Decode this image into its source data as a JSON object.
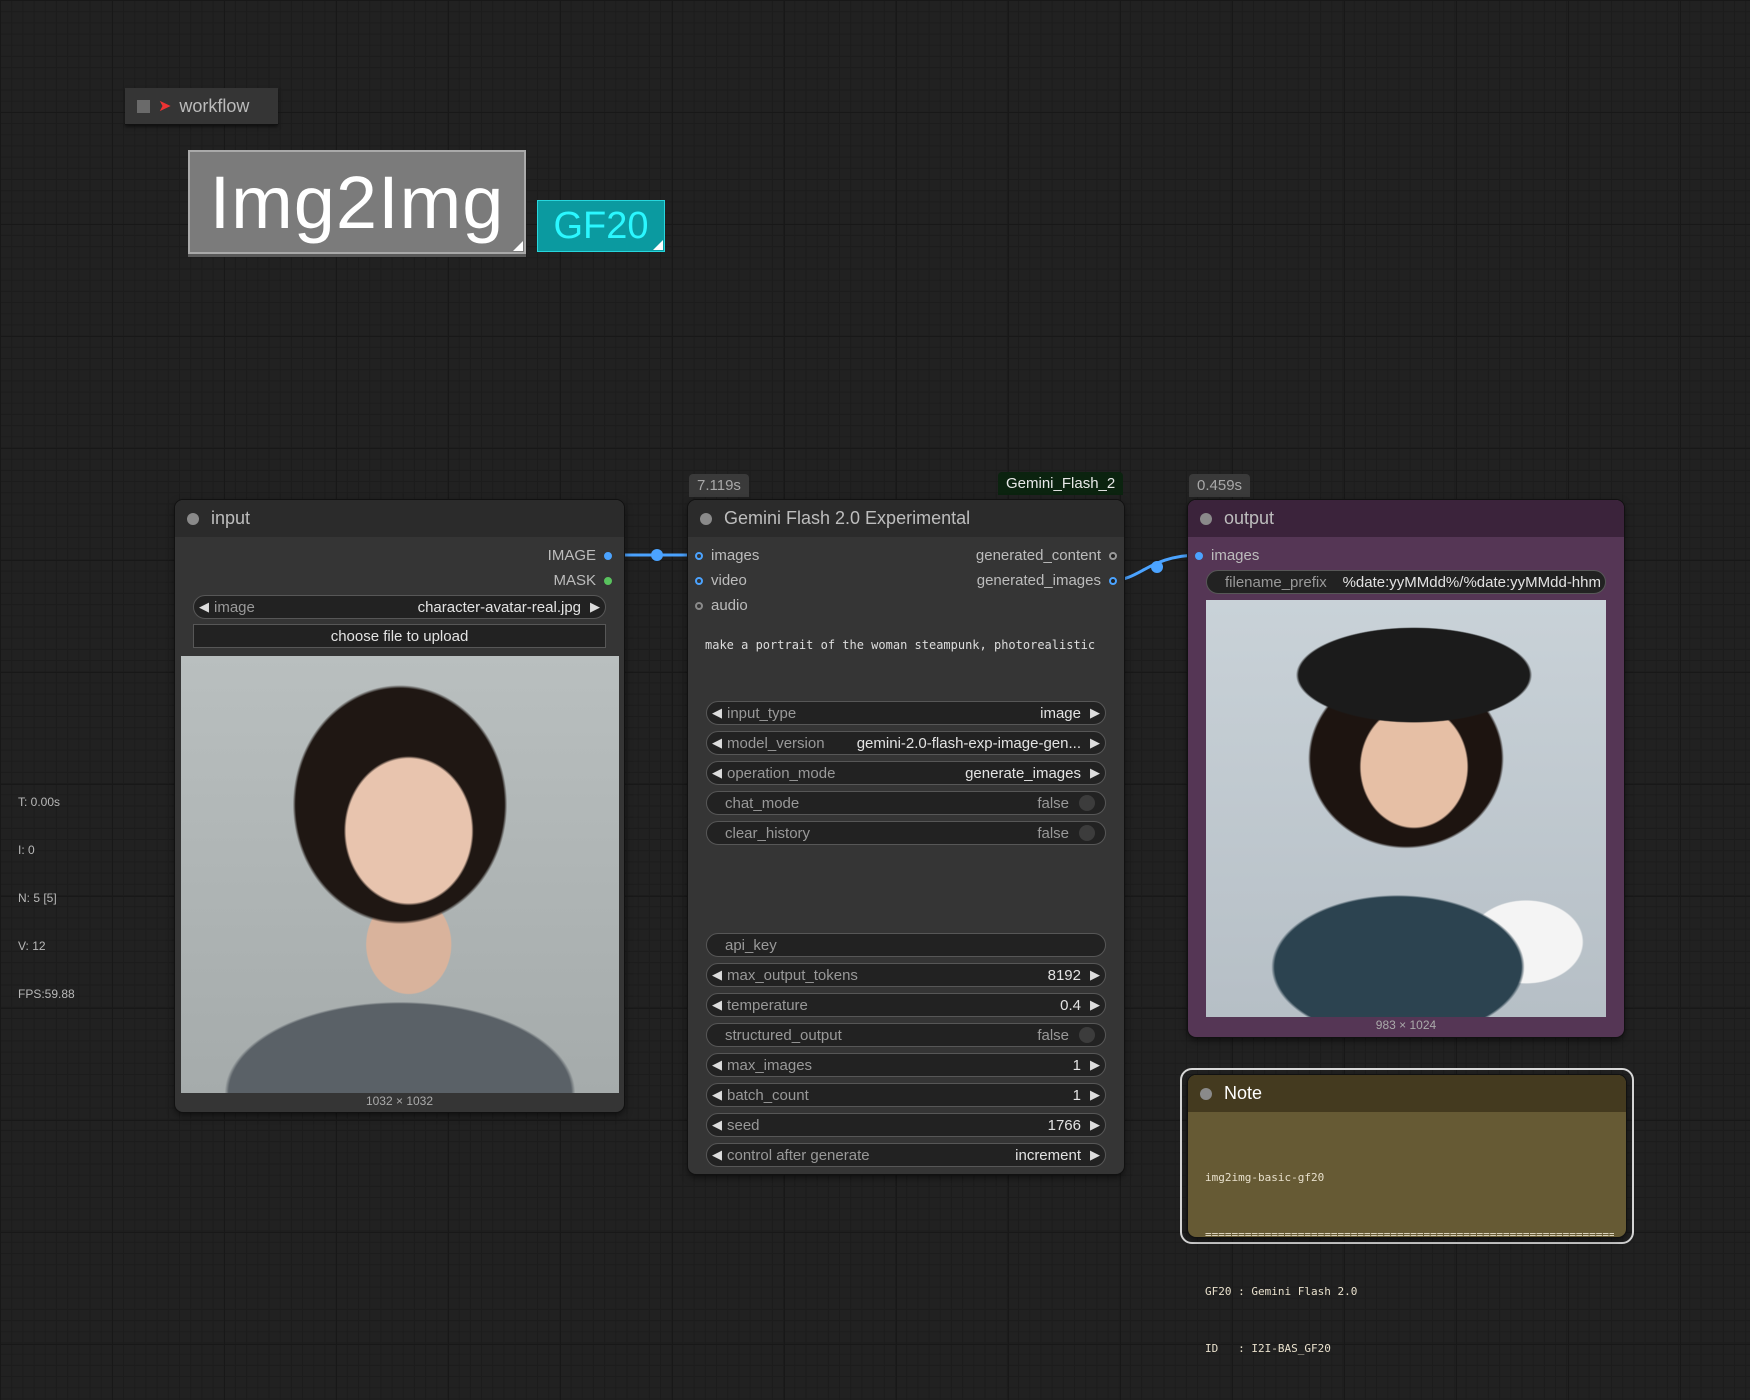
{
  "workflow": {
    "label": "workflow"
  },
  "title_label": "Img2Img",
  "badge_label": "GF20",
  "stats": {
    "t": "T: 0.00s",
    "i": "I: 0",
    "n": "N: 5 [5]",
    "v": "V: 12",
    "fps": "FPS:59.88"
  },
  "input_node": {
    "title": "input",
    "outputs": [
      "IMAGE",
      "MASK"
    ],
    "image_widget": {
      "name": "image",
      "value": "character-avatar-real.jpg"
    },
    "upload_label": "choose file to upload",
    "image_dims": "1032 × 1032"
  },
  "gemini_node": {
    "timing": "7.119s",
    "badge": "Gemini_Flash_2",
    "title": "Gemini Flash 2.0 Experimental",
    "inputs": [
      "images",
      "video",
      "audio"
    ],
    "outputs": [
      "generated_content",
      "generated_images"
    ],
    "prompt": "make a portrait of the woman steampunk, photorealistic",
    "widgets": [
      {
        "name": "input_type",
        "value": "image",
        "kind": "combo"
      },
      {
        "name": "model_version",
        "value": "gemini-2.0-flash-exp-image-gen...",
        "kind": "combo"
      },
      {
        "name": "operation_mode",
        "value": "generate_images",
        "kind": "combo"
      },
      {
        "name": "chat_mode",
        "value": "false",
        "kind": "toggle"
      },
      {
        "name": "clear_history",
        "value": "false",
        "kind": "toggle"
      }
    ],
    "widgets2": [
      {
        "name": "api_key",
        "value": "",
        "kind": "text"
      },
      {
        "name": "max_output_tokens",
        "value": "8192",
        "kind": "combo"
      },
      {
        "name": "temperature",
        "value": "0.4",
        "kind": "combo"
      },
      {
        "name": "structured_output",
        "value": "false",
        "kind": "toggle"
      },
      {
        "name": "max_images",
        "value": "1",
        "kind": "combo"
      },
      {
        "name": "batch_count",
        "value": "1",
        "kind": "combo"
      },
      {
        "name": "seed",
        "value": "1766",
        "kind": "combo"
      },
      {
        "name": "control after generate",
        "value": "increment",
        "kind": "combo"
      }
    ]
  },
  "output_node": {
    "timing": "0.459s",
    "title": "output",
    "inputs": [
      "images"
    ],
    "filename_prefix": {
      "name": "filename_prefix",
      "value": "%date:yyMMdd%/%date:yyMMdd-hhm"
    },
    "image_dims": "983 × 1024"
  },
  "note_node": {
    "title": "Note",
    "lines": [
      "img2img-basic-gf20",
      "================================================================",
      "GF20 : Gemini Flash 2.0",
      "ID   : I2I-BAS_GF20"
    ]
  },
  "colors": {
    "canvas": "#212121",
    "node": "#353535",
    "output_node": "#553655",
    "note": "#665a34",
    "wire_image": "#4ba3ff",
    "badge": "#0b9aa0"
  }
}
